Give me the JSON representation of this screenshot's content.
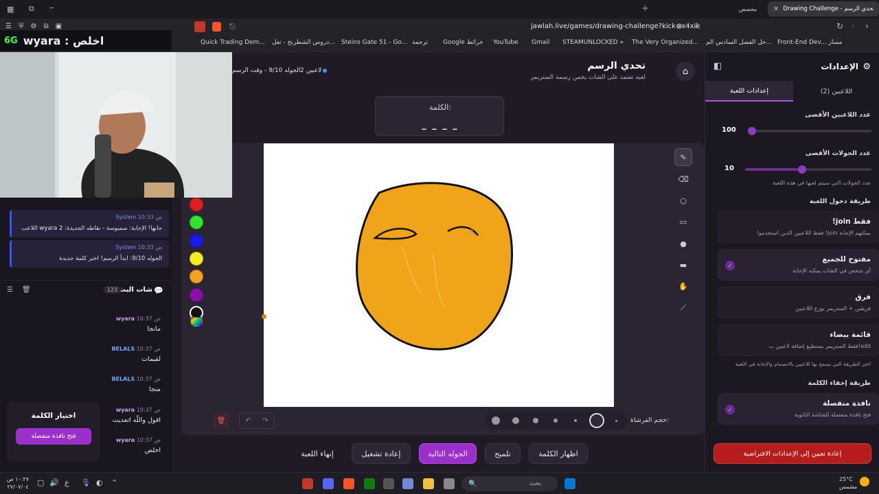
{
  "browser": {
    "tab_settings": "مخصص",
    "tab_active": "Drawing Challenge - تحدي الرسم",
    "url": "jawlah.live/games/drawing-challenge?kick=x4xik",
    "bookmarks": [
      "Quick Trading Dem...",
      "دروس الشطرنج - تعل...",
      "Steins Gate 51 - Go...",
      "ترجمة",
      "Google خرائط",
      "YouTube",
      "Gmail",
      "STEAMUNLOCKED »",
      "The Very Organized...",
      "حل الفصل السادس الم...",
      "Front-End Dev... مسار"
    ]
  },
  "stream_overlay": {
    "badge": "6G",
    "text": "wyara : اخلص"
  },
  "header": {
    "title": "تحدي الرسم",
    "subtitle": "لعبة تعتمد على الشات يخمن رسمة الستريمر",
    "players": "2 لاعبين",
    "round_info": "الجوله 9/10 - وقت الرسم"
  },
  "word_card": {
    "label": "الكلمة:",
    "mask": "_ _ _ _"
  },
  "palette": {
    "colors": [
      "#e21d1d",
      "#2ee62e",
      "#1a1ae8",
      "#f5f01c",
      "#f4a21b",
      "#8a0fa8",
      "#111111"
    ]
  },
  "tools": [
    "pencil-icon",
    "eraser-icon",
    "circle-icon",
    "rectangle-icon",
    "filled-circle-icon",
    "filled-rect-icon",
    "hand-icon",
    "line-icon"
  ],
  "bottom_bar": {
    "brush_label": "حجم الفرشاة:",
    "brush_sizes": 7
  },
  "actions": {
    "end_game": "إنهاء اللعبة",
    "restart": "إعادة تشغيل",
    "next_round": "الجوله التالية",
    "hint": "تلميح",
    "show_word": "اظهار الكلمة"
  },
  "settings": {
    "title": "الإعدادات",
    "tab_game": "إعدادات اللعبة",
    "tab_players": "اللاعبين (2)",
    "max_players_label": "عدد اللاعبين الأقصى",
    "max_players_value": "100",
    "max_players_fraction": 0.0,
    "max_rounds_label": "عدد الجولات الأقصى",
    "max_rounds_value": "10",
    "max_rounds_fraction": 0.55,
    "max_rounds_hint": "عدد الجولات التي سيتم لعبها في هذه اللعبة",
    "entry_label": "طريقة دخول اللعبة",
    "entry_options": [
      {
        "title": "!join فقط",
        "sub": "فقط اللاعبين الذين استخدموا !join يمكنهم الإجابة",
        "checked": false
      },
      {
        "title": "مفتوح للجميع",
        "sub": "أي شخص في الشات يمكنه الإجابة",
        "checked": true
      },
      {
        "title": "فرق",
        "sub": "فريقين + الستريمر يوزع اللاعبين",
        "checked": false
      },
      {
        "title": "قائمة بيضاء",
        "sub": "فقط الستريمر يستطيع إضافة لاعبين ب!add",
        "checked": false
      }
    ],
    "entry_hint": "اختر الطريقة التي يسمح بها للاعبين بالانضمام والإجابة في اللعبة",
    "hide_label": "طريقة إخفاء الكلمة",
    "hide_option": {
      "title": "نافذة منفصلة",
      "sub": "فتح نافذة منفصلة للشاشة الثانوية"
    },
    "reset_button": "إعادة تعيين إلى الإعدادات الافتراضية"
  },
  "chat": {
    "system_messages": [
      {
        "time": "10:33 ص",
        "name": "System",
        "text": "اللاعب wyara جابها! الإجابة: سمبوسة - نقاطه الجديدة: 2"
      },
      {
        "time": "10:33 ص",
        "name": "System",
        "text": "الجوله 9/10: ابدأ الرسم! اختر كلمة جديدة"
      }
    ],
    "title": "شات البث",
    "count": "123",
    "messages": [
      {
        "name": "wyara",
        "time": "10:37 ص",
        "text": "مانجا"
      },
      {
        "name": "BELALS",
        "time": "10:37 ص",
        "text": "لقيمات"
      },
      {
        "name": "BELALS",
        "time": "10:37 ص",
        "text": "منجا"
      },
      {
        "name": "wyara",
        "time": "10:37 ص",
        "text": "اقول واللّه اتعديت"
      },
      {
        "name": "wyara",
        "time": "10:37 ص",
        "text": "اخلص"
      }
    ],
    "word_select_title": "اختيار الكلمة",
    "word_select_button": "فتح نافذة منفصلة"
  },
  "taskbar": {
    "time": "١٠:٣٧ ص",
    "date": "٢٧/٠٧/٠٤",
    "weather": "25°C",
    "weather_sub": "مشمس",
    "search": "بحث"
  }
}
